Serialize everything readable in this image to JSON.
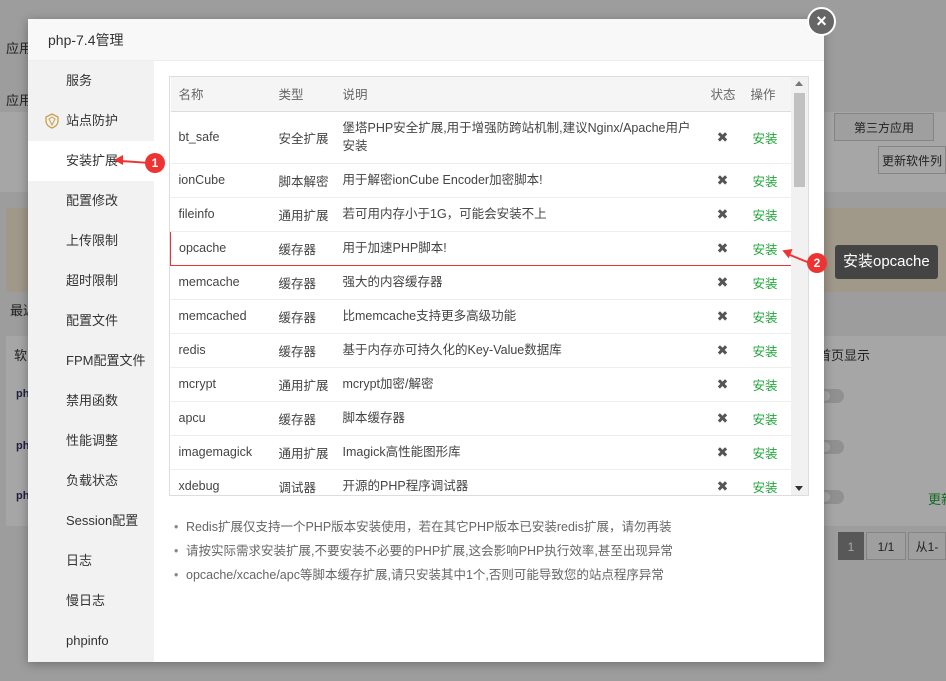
{
  "background": {
    "labels": [
      "应用",
      "应用",
      "最近",
      "软",
      "第三方应用",
      "更新软件列",
      "首页显示",
      "更新",
      "1",
      "1/1",
      "从1-"
    ],
    "plugin_prefix": "ph"
  },
  "modal": {
    "title": "php-7.4管理",
    "close_label": "×"
  },
  "sidebar": {
    "items": [
      {
        "label": "服务"
      },
      {
        "label": "站点防护"
      },
      {
        "label": "安装扩展"
      },
      {
        "label": "配置修改"
      },
      {
        "label": "上传限制"
      },
      {
        "label": "超时限制"
      },
      {
        "label": "配置文件"
      },
      {
        "label": "FPM配置文件"
      },
      {
        "label": "禁用函数"
      },
      {
        "label": "性能调整"
      },
      {
        "label": "负载状态"
      },
      {
        "label": "Session配置"
      },
      {
        "label": "日志"
      },
      {
        "label": "慢日志"
      },
      {
        "label": "phpinfo"
      }
    ]
  },
  "table": {
    "headers": {
      "name": "名称",
      "type": "类型",
      "desc": "说明",
      "status": "状态",
      "op": "操作"
    },
    "rows": [
      {
        "name": "bt_safe",
        "type": "安全扩展",
        "desc": "堡塔PHP安全扩展,用于增强防跨站机制,建议Nginx/Apache用户安装",
        "status": "✖",
        "op": "安装"
      },
      {
        "name": "ionCube",
        "type": "脚本解密",
        "desc": "用于解密ionCube Encoder加密脚本!",
        "status": "✖",
        "op": "安装"
      },
      {
        "name": "fileinfo",
        "type": "通用扩展",
        "desc": "若可用内存小于1G，可能会安装不上",
        "status": "✖",
        "op": "安装"
      },
      {
        "name": "opcache",
        "type": "缓存器",
        "desc": "用于加速PHP脚本!",
        "status": "✖",
        "op": "安装"
      },
      {
        "name": "memcache",
        "type": "缓存器",
        "desc": "强大的内容缓存器",
        "status": "✖",
        "op": "安装"
      },
      {
        "name": "memcached",
        "type": "缓存器",
        "desc": "比memcache支持更多高级功能",
        "status": "✖",
        "op": "安装"
      },
      {
        "name": "redis",
        "type": "缓存器",
        "desc": "基于内存亦可持久化的Key-Value数据库",
        "status": "✖",
        "op": "安装"
      },
      {
        "name": "mcrypt",
        "type": "通用扩展",
        "desc": "mcrypt加密/解密",
        "status": "✖",
        "op": "安装"
      },
      {
        "name": "apcu",
        "type": "缓存器",
        "desc": "脚本缓存器",
        "status": "✖",
        "op": "安装"
      },
      {
        "name": "imagemagick",
        "type": "通用扩展",
        "desc": "Imagick高性能图形库",
        "status": "✖",
        "op": "安装"
      },
      {
        "name": "xdebug",
        "type": "调试器",
        "desc": "开源的PHP程序调试器",
        "status": "✖",
        "op": "安装"
      }
    ]
  },
  "notes": [
    "Redis扩展仅支持一个PHP版本安装使用，若在其它PHP版本已安装redis扩展，请勿再装",
    "请按实际需求安装扩展,不要安装不必要的PHP扩展,这会影响PHP执行效率,甚至出现异常",
    "opcache/xcache/apc等脚本缓存扩展,请只安装其中1个,否则可能导致您的站点程序异常"
  ],
  "annotations": {
    "badge1": "1",
    "badge2": "2",
    "tooltip": "安装opcache"
  },
  "colors": {
    "accent": "#20a53a",
    "highlight": "#e33333"
  }
}
